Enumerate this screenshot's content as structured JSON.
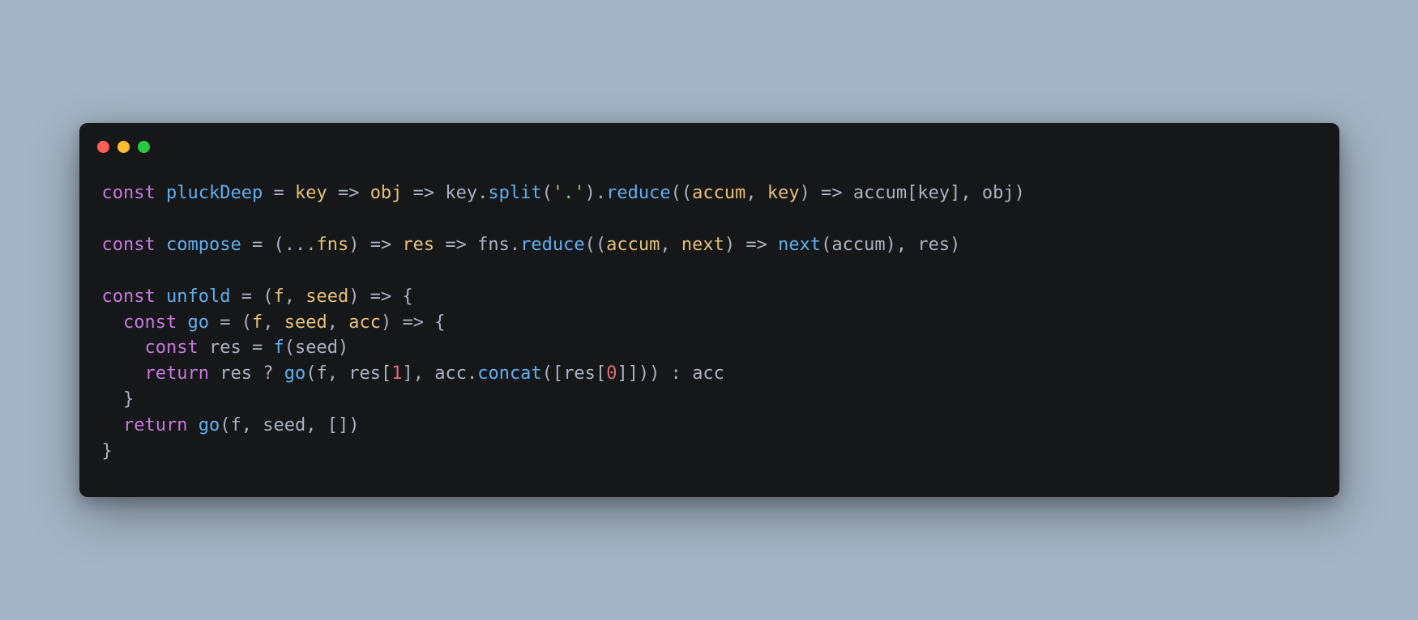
{
  "language": "javascript",
  "traffic_lights": [
    "close",
    "minimize",
    "zoom"
  ],
  "code": {
    "plain": "const pluckDeep = key => obj => key.split('.').reduce((accum, key) => accum[key], obj)\n\nconst compose = (...fns) => res => fns.reduce((accum, next) => next(accum), res)\n\nconst unfold = (f, seed) => {\n  const go = (f, seed, acc) => {\n    const res = f(seed)\n    return res ? go(f, res[1], acc.concat([res[0]])) : acc\n  }\n  return go(f, seed, [])\n}",
    "tokens": [
      [
        {
          "t": "const ",
          "c": "kw"
        },
        {
          "t": "pluckDeep",
          "c": "fn"
        },
        {
          "t": " = ",
          "c": "op"
        },
        {
          "t": "key",
          "c": "prm"
        },
        {
          "t": " => ",
          "c": "op"
        },
        {
          "t": "obj",
          "c": "prm"
        },
        {
          "t": " => ",
          "c": "op"
        },
        {
          "t": "key",
          "c": "id"
        },
        {
          "t": ".",
          "c": "pun"
        },
        {
          "t": "split",
          "c": "fn"
        },
        {
          "t": "(",
          "c": "pun"
        },
        {
          "t": "'.'",
          "c": "str"
        },
        {
          "t": ")",
          "c": "pun"
        },
        {
          "t": ".",
          "c": "pun"
        },
        {
          "t": "reduce",
          "c": "fn"
        },
        {
          "t": "((",
          "c": "pun"
        },
        {
          "t": "accum",
          "c": "prm"
        },
        {
          "t": ", ",
          "c": "pun"
        },
        {
          "t": "key",
          "c": "prm"
        },
        {
          "t": ") => ",
          "c": "op"
        },
        {
          "t": "accum",
          "c": "id"
        },
        {
          "t": "[",
          "c": "pun"
        },
        {
          "t": "key",
          "c": "id"
        },
        {
          "t": "]",
          "c": "pun"
        },
        {
          "t": ", ",
          "c": "pun"
        },
        {
          "t": "obj",
          "c": "id"
        },
        {
          "t": ")",
          "c": "pun"
        }
      ],
      [],
      [
        {
          "t": "const ",
          "c": "kw"
        },
        {
          "t": "compose",
          "c": "fn"
        },
        {
          "t": " = ",
          "c": "op"
        },
        {
          "t": "(",
          "c": "pun"
        },
        {
          "t": "...",
          "c": "op"
        },
        {
          "t": "fns",
          "c": "prm"
        },
        {
          "t": ")",
          "c": "pun"
        },
        {
          "t": " => ",
          "c": "op"
        },
        {
          "t": "res",
          "c": "prm"
        },
        {
          "t": " => ",
          "c": "op"
        },
        {
          "t": "fns",
          "c": "id"
        },
        {
          "t": ".",
          "c": "pun"
        },
        {
          "t": "reduce",
          "c": "fn"
        },
        {
          "t": "((",
          "c": "pun"
        },
        {
          "t": "accum",
          "c": "prm"
        },
        {
          "t": ", ",
          "c": "pun"
        },
        {
          "t": "next",
          "c": "prm"
        },
        {
          "t": ") => ",
          "c": "op"
        },
        {
          "t": "next",
          "c": "fn"
        },
        {
          "t": "(",
          "c": "pun"
        },
        {
          "t": "accum",
          "c": "id"
        },
        {
          "t": ")",
          "c": "pun"
        },
        {
          "t": ", ",
          "c": "pun"
        },
        {
          "t": "res",
          "c": "id"
        },
        {
          "t": ")",
          "c": "pun"
        }
      ],
      [],
      [
        {
          "t": "const ",
          "c": "kw"
        },
        {
          "t": "unfold",
          "c": "fn"
        },
        {
          "t": " = ",
          "c": "op"
        },
        {
          "t": "(",
          "c": "pun"
        },
        {
          "t": "f",
          "c": "prm"
        },
        {
          "t": ", ",
          "c": "pun"
        },
        {
          "t": "seed",
          "c": "prm"
        },
        {
          "t": ")",
          "c": "pun"
        },
        {
          "t": " => ",
          "c": "op"
        },
        {
          "t": "{",
          "c": "pun"
        }
      ],
      [
        {
          "t": "  ",
          "c": "pun"
        },
        {
          "t": "const ",
          "c": "kw"
        },
        {
          "t": "go",
          "c": "fn"
        },
        {
          "t": " = ",
          "c": "op"
        },
        {
          "t": "(",
          "c": "pun"
        },
        {
          "t": "f",
          "c": "prm"
        },
        {
          "t": ", ",
          "c": "pun"
        },
        {
          "t": "seed",
          "c": "prm"
        },
        {
          "t": ", ",
          "c": "pun"
        },
        {
          "t": "acc",
          "c": "prm"
        },
        {
          "t": ")",
          "c": "pun"
        },
        {
          "t": " => ",
          "c": "op"
        },
        {
          "t": "{",
          "c": "pun"
        }
      ],
      [
        {
          "t": "    ",
          "c": "pun"
        },
        {
          "t": "const ",
          "c": "kw"
        },
        {
          "t": "res",
          "c": "id"
        },
        {
          "t": " = ",
          "c": "op"
        },
        {
          "t": "f",
          "c": "fn"
        },
        {
          "t": "(",
          "c": "pun"
        },
        {
          "t": "seed",
          "c": "id"
        },
        {
          "t": ")",
          "c": "pun"
        }
      ],
      [
        {
          "t": "    ",
          "c": "pun"
        },
        {
          "t": "return ",
          "c": "ret"
        },
        {
          "t": "res",
          "c": "id"
        },
        {
          "t": " ? ",
          "c": "op"
        },
        {
          "t": "go",
          "c": "fn"
        },
        {
          "t": "(",
          "c": "pun"
        },
        {
          "t": "f",
          "c": "id"
        },
        {
          "t": ", ",
          "c": "pun"
        },
        {
          "t": "res",
          "c": "id"
        },
        {
          "t": "[",
          "c": "pun"
        },
        {
          "t": "1",
          "c": "num"
        },
        {
          "t": "]",
          "c": "pun"
        },
        {
          "t": ", ",
          "c": "pun"
        },
        {
          "t": "acc",
          "c": "id"
        },
        {
          "t": ".",
          "c": "pun"
        },
        {
          "t": "concat",
          "c": "fn"
        },
        {
          "t": "([",
          "c": "pun"
        },
        {
          "t": "res",
          "c": "id"
        },
        {
          "t": "[",
          "c": "pun"
        },
        {
          "t": "0",
          "c": "num"
        },
        {
          "t": "]",
          "c": "pun"
        },
        {
          "t": "]))",
          "c": "pun"
        },
        {
          "t": " : ",
          "c": "op"
        },
        {
          "t": "acc",
          "c": "id"
        }
      ],
      [
        {
          "t": "  }",
          "c": "pun"
        }
      ],
      [
        {
          "t": "  ",
          "c": "pun"
        },
        {
          "t": "return ",
          "c": "ret"
        },
        {
          "t": "go",
          "c": "fn"
        },
        {
          "t": "(",
          "c": "pun"
        },
        {
          "t": "f",
          "c": "id"
        },
        {
          "t": ", ",
          "c": "pun"
        },
        {
          "t": "seed",
          "c": "id"
        },
        {
          "t": ", ",
          "c": "pun"
        },
        {
          "t": "[]",
          "c": "pun"
        },
        {
          "t": ")",
          "c": "pun"
        }
      ],
      [
        {
          "t": "}",
          "c": "pun"
        }
      ]
    ]
  }
}
